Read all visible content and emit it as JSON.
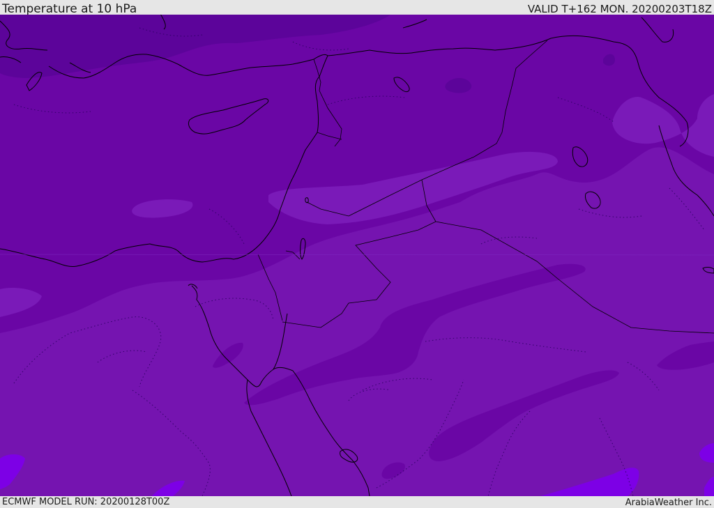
{
  "header": {
    "title": "Temperature at 10 hPa",
    "valid": "VALID T+162 MON. 20200203T18Z"
  },
  "footer": {
    "model_run": "ECMWF MODEL RUN: 20200128T00Z",
    "credit": "ArabiaWeather Inc."
  },
  "map": {
    "colors": {
      "base_south": "#7514b0",
      "dark_band": "#6a06a5",
      "darker_patch": "#5c049a",
      "light_patch": "#7a1ab8",
      "bright_patch": "#7d00e6",
      "coastline": "#000000"
    },
    "icons": [
      "coastline-lines",
      "border-lines",
      "contour-lines"
    ]
  }
}
